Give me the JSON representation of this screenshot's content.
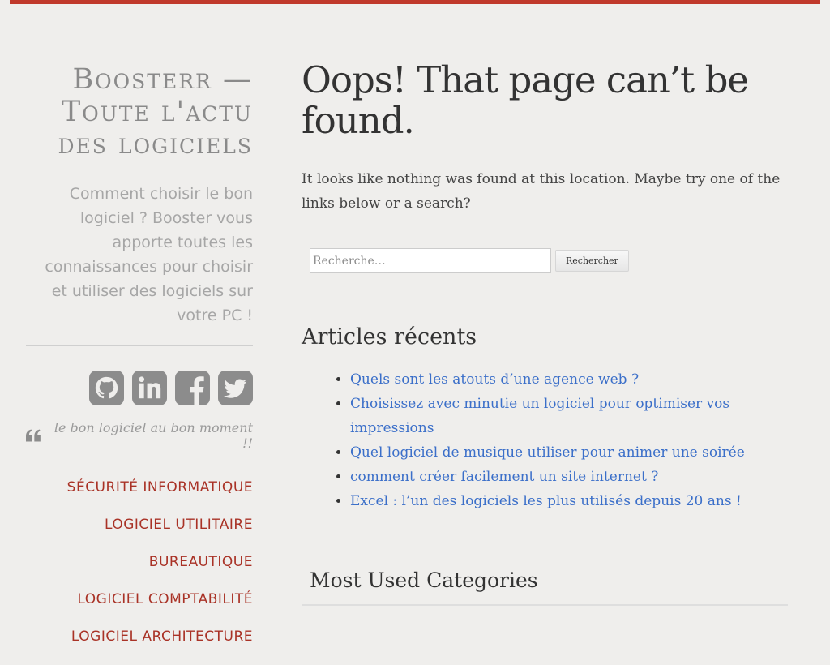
{
  "colors": {
    "accent": "#c0392b",
    "nav_link": "#a93226",
    "post_link": "#3b6fc9",
    "background": "#efeeec",
    "social_icon": "#8c8c8c"
  },
  "sidebar": {
    "site_title": "Boosterr — Toute l'actu des logiciels",
    "site_description": "Comment choisir le bon logiciel ? Booster vous apporte toutes les connaissances pour choisir et utiliser des logiciels sur votre PC !",
    "social_icons": [
      "github-icon",
      "linkedin-icon",
      "facebook-icon",
      "twitter-icon"
    ],
    "tagline": "le bon logiciel au bon moment !!",
    "nav_items": [
      {
        "label": "SÉCURITÉ INFORMATIQUE"
      },
      {
        "label": "LOGICIEL UTILITAIRE"
      },
      {
        "label": "BUREAUTIQUE"
      },
      {
        "label": "LOGICIEL COMPTABILITÉ"
      },
      {
        "label": "LOGICIEL ARCHITECTURE"
      }
    ]
  },
  "main": {
    "page_title": "Oops! That page can’t be found.",
    "intro": "It looks like nothing was found at this location. Maybe try one of the links below or a search?",
    "search": {
      "placeholder": "Recherche…",
      "button_label": "Rechercher"
    },
    "recent_posts": {
      "title": "Articles récents",
      "items": [
        {
          "label": "Quels sont les atouts d’une agence web ?"
        },
        {
          "label": "Choisissez avec minutie un logiciel pour optimiser vos impressions"
        },
        {
          "label": "Quel logiciel de musique utiliser pour animer une soirée"
        },
        {
          "label": "comment créer facilement un site internet ?"
        },
        {
          "label": "Excel : l’un des logiciels les plus utilisés depuis 20 ans !"
        }
      ]
    },
    "categories": {
      "title": "Most Used Categories"
    }
  }
}
